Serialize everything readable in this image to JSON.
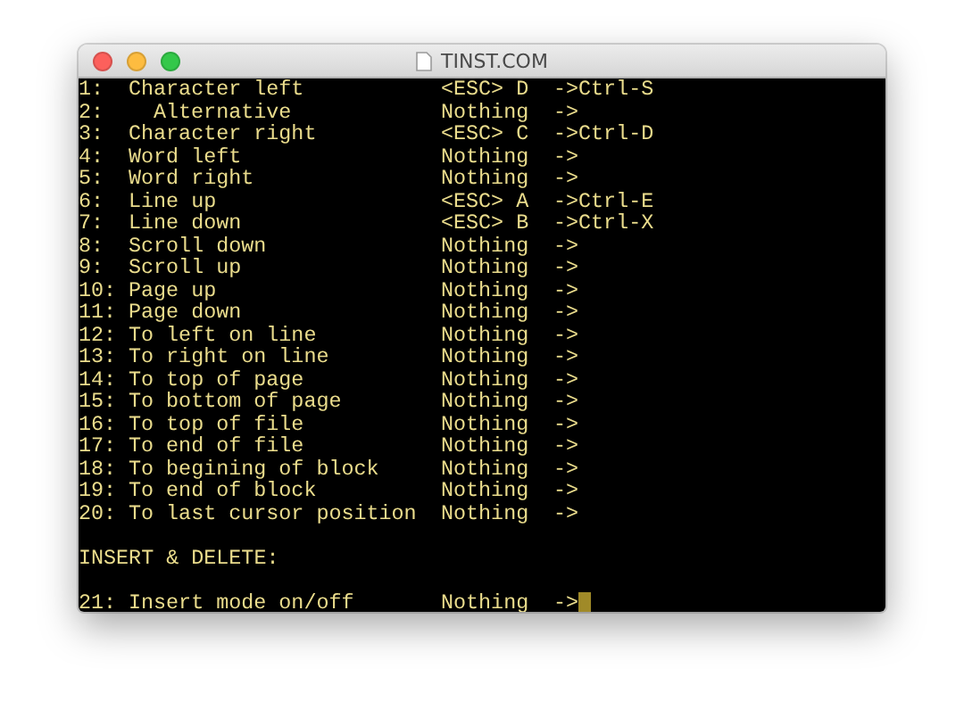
{
  "window": {
    "title": "TINST.COM"
  },
  "lines": [
    {
      "kind": "entry",
      "number": "1:",
      "label": "Character left",
      "key": "<ESC> D",
      "mapping": "->Ctrl-S"
    },
    {
      "kind": "sub-entry",
      "number": "2:",
      "label": "Alternative",
      "key": "Nothing",
      "mapping": "->"
    },
    {
      "kind": "entry",
      "number": "3:",
      "label": "Character right",
      "key": "<ESC> C",
      "mapping": "->Ctrl-D"
    },
    {
      "kind": "entry",
      "number": "4:",
      "label": "Word left",
      "key": "Nothing",
      "mapping": "->"
    },
    {
      "kind": "entry",
      "number": "5:",
      "label": "Word right",
      "key": "Nothing",
      "mapping": "->"
    },
    {
      "kind": "entry",
      "number": "6:",
      "label": "Line up",
      "key": "<ESC> A",
      "mapping": "->Ctrl-E"
    },
    {
      "kind": "entry",
      "number": "7:",
      "label": "Line down",
      "key": "<ESC> B",
      "mapping": "->Ctrl-X"
    },
    {
      "kind": "entry",
      "number": "8:",
      "label": "Scroll down",
      "key": "Nothing",
      "mapping": "->"
    },
    {
      "kind": "entry",
      "number": "9:",
      "label": "Scroll up",
      "key": "Nothing",
      "mapping": "->"
    },
    {
      "kind": "entry",
      "number": "10:",
      "label": "Page up",
      "key": "Nothing",
      "mapping": "->"
    },
    {
      "kind": "entry",
      "number": "11:",
      "label": "Page down",
      "key": "Nothing",
      "mapping": "->"
    },
    {
      "kind": "entry",
      "number": "12:",
      "label": "To left on line",
      "key": "Nothing",
      "mapping": "->"
    },
    {
      "kind": "entry",
      "number": "13:",
      "label": "To right on line",
      "key": "Nothing",
      "mapping": "->"
    },
    {
      "kind": "entry",
      "number": "14:",
      "label": "To top of page",
      "key": "Nothing",
      "mapping": "->"
    },
    {
      "kind": "entry",
      "number": "15:",
      "label": "To bottom of page",
      "key": "Nothing",
      "mapping": "->"
    },
    {
      "kind": "entry",
      "number": "16:",
      "label": "To top of file",
      "key": "Nothing",
      "mapping": "->"
    },
    {
      "kind": "entry",
      "number": "17:",
      "label": "To end of file",
      "key": "Nothing",
      "mapping": "->"
    },
    {
      "kind": "entry",
      "number": "18:",
      "label": "To begining of block",
      "key": "Nothing",
      "mapping": "->"
    },
    {
      "kind": "entry",
      "number": "19:",
      "label": "To end of block",
      "key": "Nothing",
      "mapping": "->"
    },
    {
      "kind": "entry",
      "number": "20:",
      "label": "To last cursor position",
      "key": "Nothing",
      "mapping": "->"
    },
    {
      "kind": "blank"
    },
    {
      "kind": "heading",
      "text": "INSERT & DELETE:"
    },
    {
      "kind": "blank"
    },
    {
      "kind": "entry",
      "number": "21:",
      "label": "Insert mode on/off",
      "key": "Nothing",
      "mapping": "->",
      "cursor": true
    }
  ]
}
